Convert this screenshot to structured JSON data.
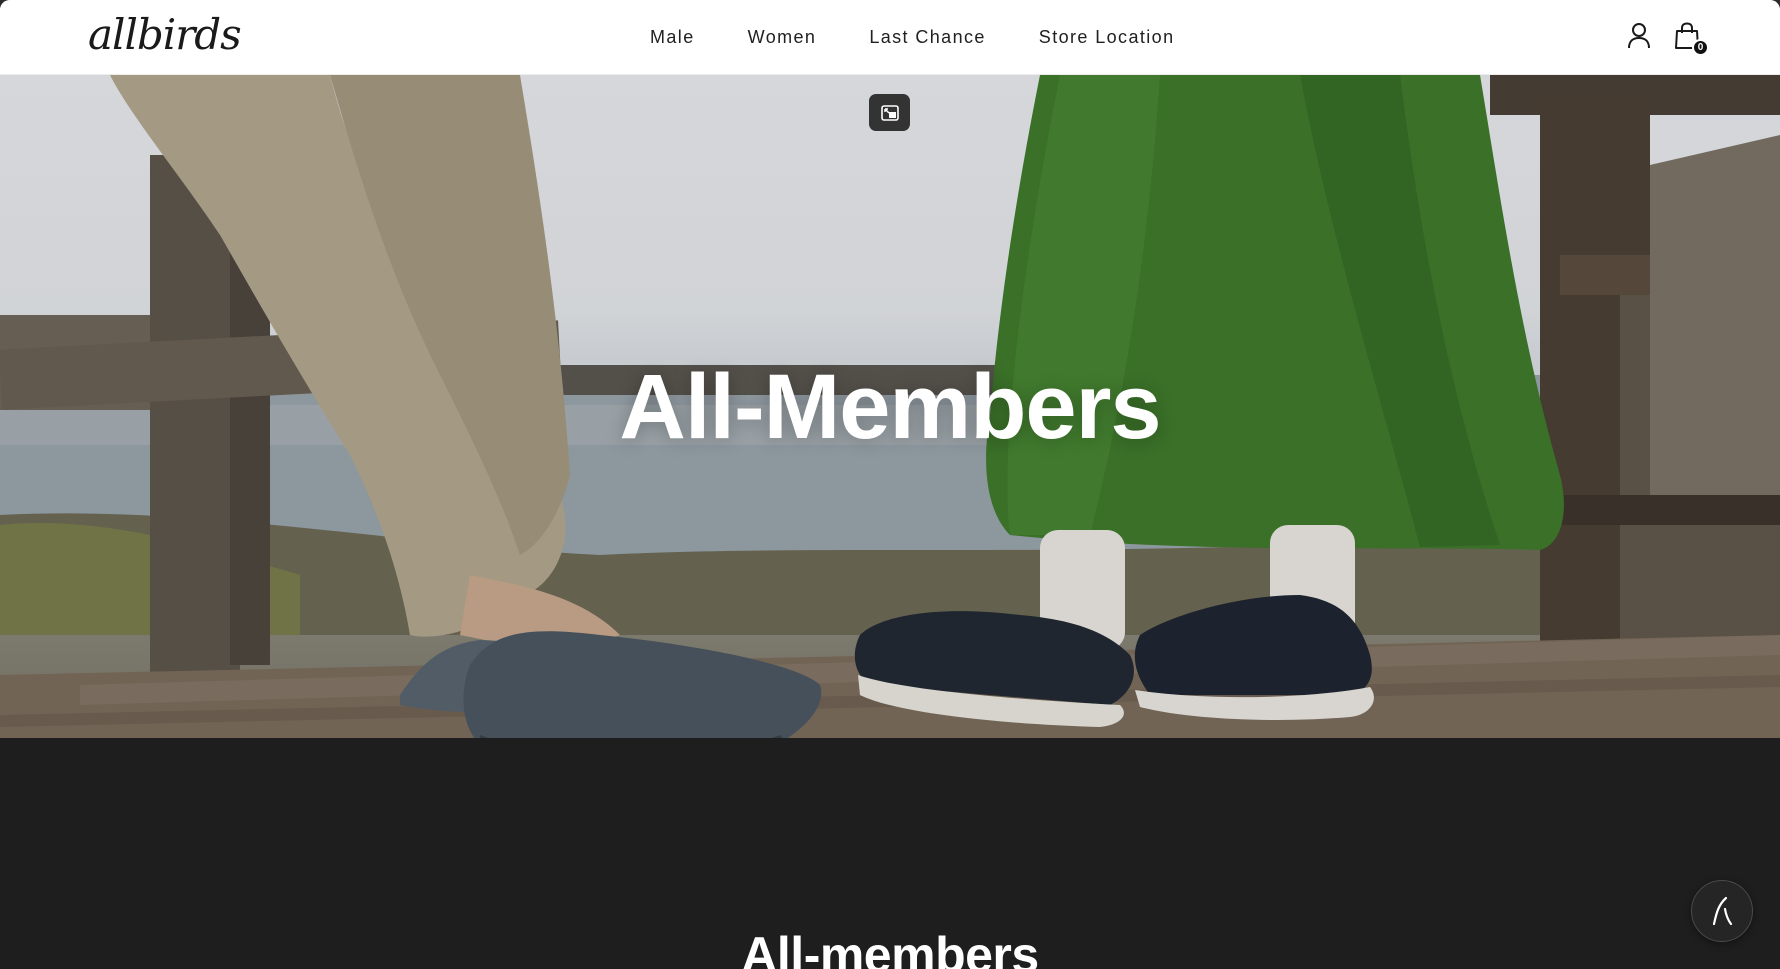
{
  "header": {
    "logo_text": "allbirds",
    "nav": [
      "Male",
      "Women",
      "Last Chance",
      "Store Location"
    ],
    "account_icon": "user-icon",
    "cart_icon": "shopping-bag-icon",
    "cart_count": "0"
  },
  "hero": {
    "title": "All-Members",
    "pip_icon": "picture-in-picture-icon"
  },
  "section": {
    "title": "All-members"
  },
  "chat": {
    "icon": "chat-assistant-icon"
  },
  "colors": {
    "header_bg": "#ffffff",
    "dark_section_bg": "#1e1e1e",
    "text_dark": "#212121",
    "hero_text": "#ffffff",
    "green_skirt": "#3f7a2c"
  }
}
